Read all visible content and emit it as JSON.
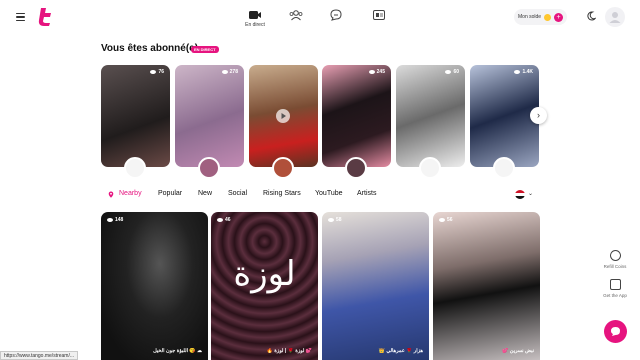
{
  "header": {
    "nav_live_label": "En direct",
    "solde_label": "Mon solde",
    "plus": "+"
  },
  "subscribed": {
    "title": "Vous êtes abonné(e)",
    "badge": "EN DIRECT",
    "cards": [
      {
        "views": "76",
        "bg": "#3a3535"
      },
      {
        "views": "278",
        "bg": "#b9a0b7"
      },
      {
        "views": "",
        "bg": "#8b5b45"
      },
      {
        "views": "245",
        "bg": "#d07a90"
      },
      {
        "views": "60",
        "bg": "#7a7a7a"
      },
      {
        "views": "1.4K",
        "bg": "#33415e"
      }
    ]
  },
  "tabs": [
    "Nearby",
    "Popular",
    "New",
    "Social",
    "Rising Stars",
    "YouTube",
    "Artists"
  ],
  "streams": [
    {
      "views": "148",
      "caption": "اللبؤة جون الخيل 😘 ☁",
      "bg": "#1b1b1b"
    },
    {
      "views": "46",
      "caption": "🔥 لوزة 🌹 | لوزة 💕",
      "bg": "#3c1f2a",
      "overlay_text": "لوزة"
    },
    {
      "views": "58",
      "caption": "👑 هزار 🌹 عمرهالي",
      "bg": "#6c80b0"
    },
    {
      "views": "56",
      "caption": "💕 نبض نسرين",
      "bg": "#8a8a8a"
    }
  ],
  "side": {
    "refill_label": "Refill Coins",
    "app_label": "Get the App"
  },
  "status_url": "https://www.tango.me/stream/...",
  "colors": {
    "accent": "#e6147f",
    "coin": "#ffc72e"
  }
}
